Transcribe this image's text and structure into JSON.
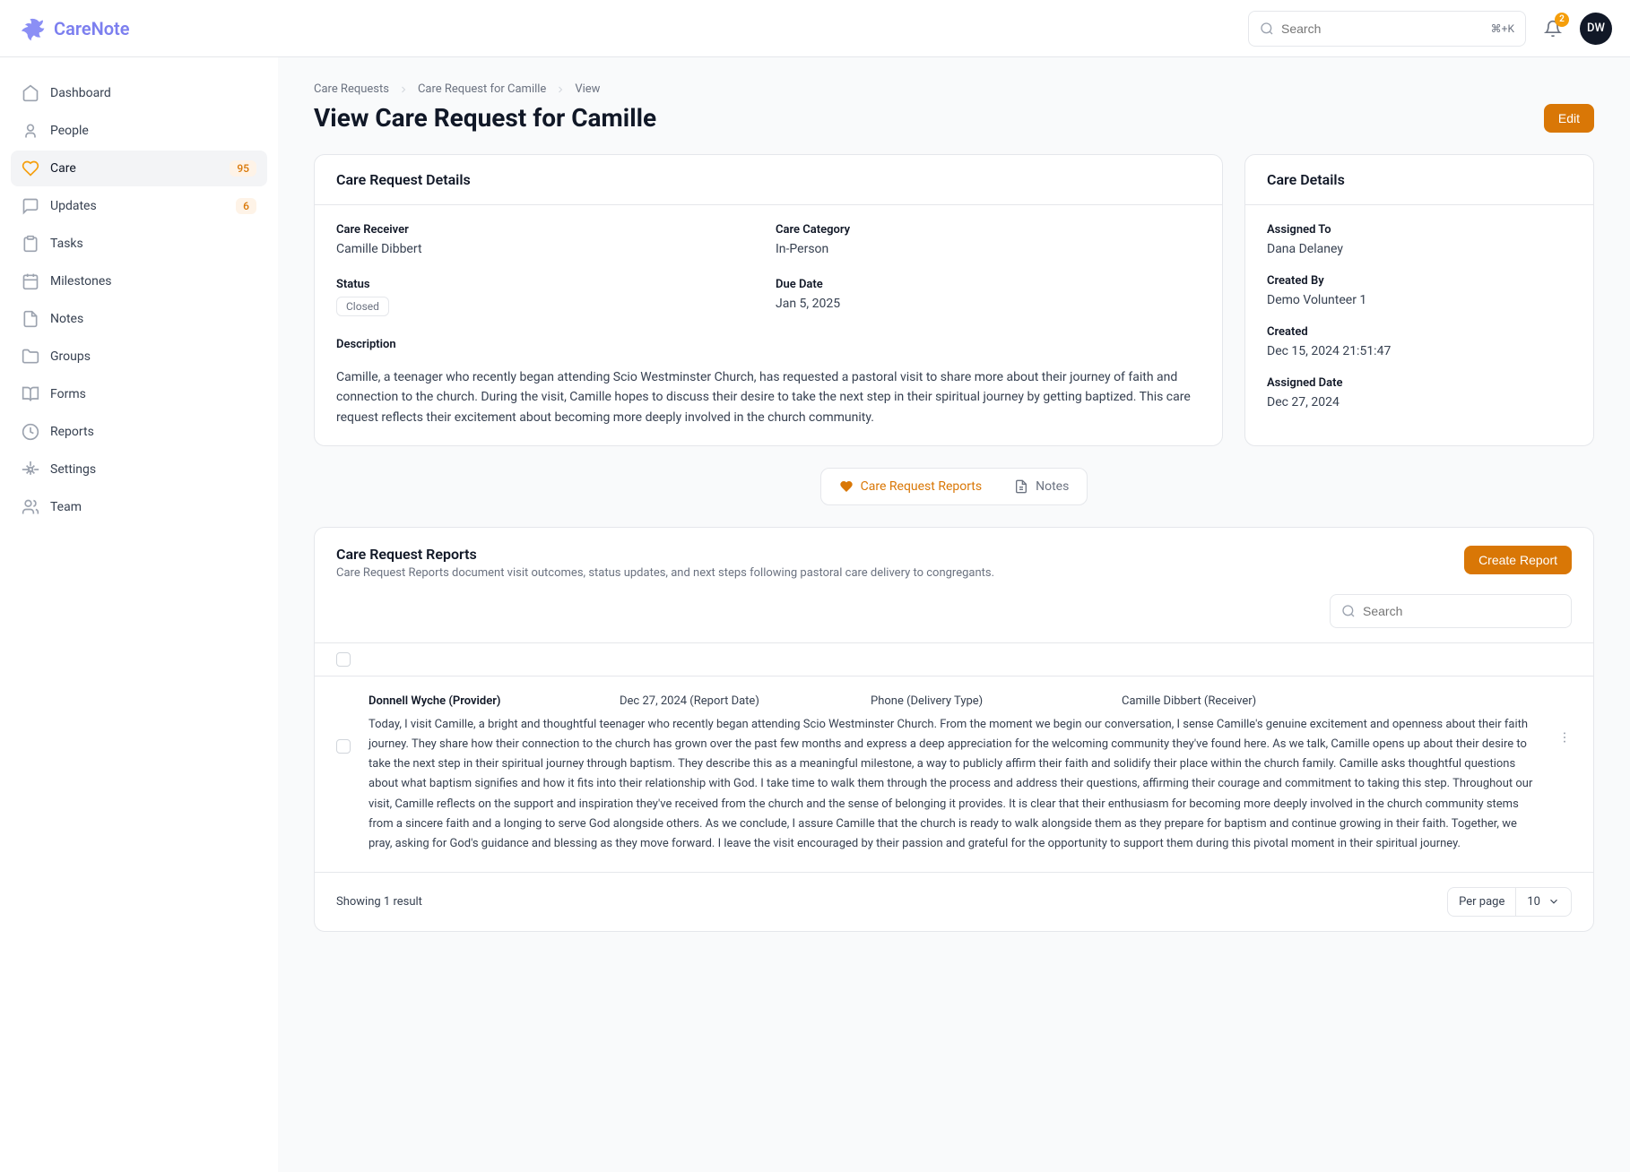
{
  "brand": {
    "name": "CareNote"
  },
  "header": {
    "search_placeholder": "Search",
    "search_shortcut": "⌘+K",
    "notifications": "2",
    "avatar_initials": "DW"
  },
  "sidebar": {
    "items": [
      {
        "label": "Dashboard"
      },
      {
        "label": "People"
      },
      {
        "label": "Care",
        "badge": "95"
      },
      {
        "label": "Updates",
        "badge": "6"
      },
      {
        "label": "Tasks"
      },
      {
        "label": "Milestones"
      },
      {
        "label": "Notes"
      },
      {
        "label": "Groups"
      },
      {
        "label": "Forms"
      },
      {
        "label": "Reports"
      },
      {
        "label": "Settings"
      },
      {
        "label": "Team"
      }
    ]
  },
  "breadcrumb": {
    "a": "Care Requests",
    "b": "Care Request for Camille",
    "c": "View"
  },
  "page": {
    "title": "View Care Request for Camille",
    "edit_label": "Edit"
  },
  "details": {
    "card_title": "Care Request Details",
    "receiver_label": "Care Receiver",
    "receiver_value": "Camille Dibbert",
    "category_label": "Care Category",
    "category_value": "In-Person",
    "status_label": "Status",
    "status_value": "Closed",
    "due_label": "Due Date",
    "due_value": "Jan 5, 2025",
    "description_label": "Description",
    "description_value": "Camille, a teenager who recently began attending Scio Westminster Church, has requested a pastoral visit to share more about their journey of faith and connection to the church. During the visit, Camille hopes to discuss their desire to take the next step in their spiritual journey by getting baptized. This care request reflects their excitement about becoming more deeply involved in the church community."
  },
  "care": {
    "card_title": "Care Details",
    "assigned_to_label": "Assigned To",
    "assigned_to_value": "Dana Delaney",
    "created_by_label": "Created By",
    "created_by_value": "Demo Volunteer 1",
    "created_label": "Created",
    "created_value": "Dec 15, 2024 21:51:47",
    "assigned_date_label": "Assigned Date",
    "assigned_date_value": "Dec 27, 2024"
  },
  "tabs": {
    "reports_label": "Care Request Reports",
    "notes_label": "Notes"
  },
  "reports": {
    "title": "Care Request Reports",
    "subtitle": "Care Request Reports document visit outcomes, status updates, and next steps following pastoral care delivery to congregants.",
    "create_label": "Create Report",
    "search_placeholder": "Search",
    "row": {
      "provider": "Donnell Wyche (Provider)",
      "date": "Dec 27, 2024 (Report Date)",
      "delivery": "Phone (Delivery Type)",
      "receiver": "Camille Dibbert (Receiver)",
      "body": "Today, I visit Camille, a bright and thoughtful teenager who recently began attending Scio Westminster Church. From the moment we begin our conversation, I sense Camille's genuine excitement and openness about their faith journey. They share how their connection to the church has grown over the past few months and express a deep appreciation for the welcoming community they've found here. As we talk, Camille opens up about their desire to take the next step in their spiritual journey through baptism. They describe this as a meaningful milestone, a way to publicly affirm their faith and solidify their place within the church family. Camille asks thoughtful questions about what baptism signifies and how it fits into their relationship with God. I take time to walk them through the process and address their questions, affirming their courage and commitment to taking this step. Throughout our visit, Camille reflects on the support and inspiration they've received from the church and the sense of belonging it provides. It is clear that their enthusiasm for becoming more deeply involved in the church community stems from a sincere faith and a longing to serve God alongside others. As we conclude, I assure Camille that the church is ready to walk alongside them as they prepare for baptism and continue growing in their faith. Together, we pray, asking for God's guidance and blessing as they move forward. I leave the visit encouraged by their passion and grateful for the opportunity to support them during this pivotal moment in their spiritual journey."
    },
    "footer": {
      "showing": "Showing 1 result",
      "per_page_label": "Per page",
      "per_page_value": "10"
    }
  }
}
